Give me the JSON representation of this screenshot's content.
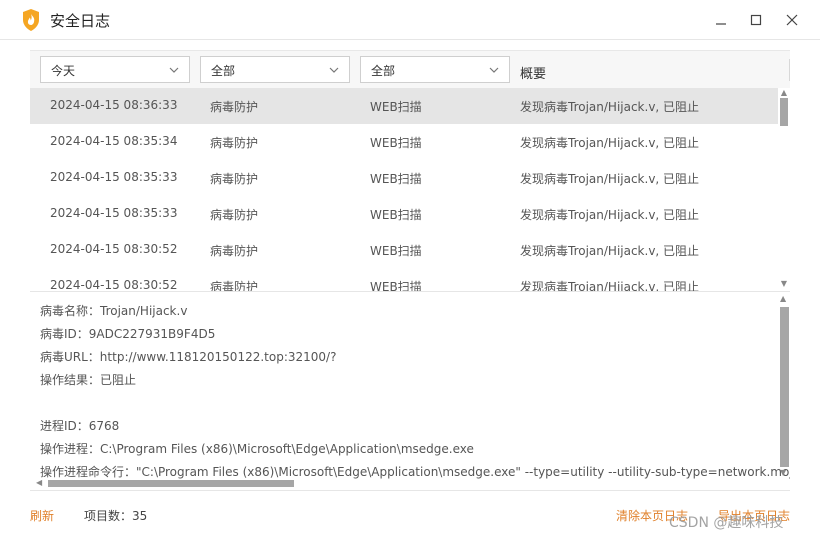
{
  "window": {
    "title": "安全日志",
    "app_icon": "shield-fire-icon",
    "controls": [
      "minimize-icon",
      "maximize-icon",
      "close-icon"
    ]
  },
  "filters": {
    "time": "今天",
    "category": "全部",
    "type": "全部",
    "summary_header": "概要"
  },
  "rows": [
    {
      "time": "2024-04-15 08:36:33",
      "category": "病毒防护",
      "type": "WEB扫描",
      "summary": "发现病毒Trojan/Hijack.v, 已阻止"
    },
    {
      "time": "2024-04-15 08:35:34",
      "category": "病毒防护",
      "type": "WEB扫描",
      "summary": "发现病毒Trojan/Hijack.v, 已阻止"
    },
    {
      "time": "2024-04-15 08:35:33",
      "category": "病毒防护",
      "type": "WEB扫描",
      "summary": "发现病毒Trojan/Hijack.v, 已阻止"
    },
    {
      "time": "2024-04-15 08:35:33",
      "category": "病毒防护",
      "type": "WEB扫描",
      "summary": "发现病毒Trojan/Hijack.v, 已阻止"
    },
    {
      "time": "2024-04-15 08:30:52",
      "category": "病毒防护",
      "type": "WEB扫描",
      "summary": "发现病毒Trojan/Hijack.v, 已阻止"
    },
    {
      "time": "2024-04-15 08:30:52",
      "category": "病毒防护",
      "type": "WEB扫描",
      "summary": "发现病毒Trojan/Hijack.v, 已阻止"
    }
  ],
  "details": {
    "virus_name": "病毒名称：Trojan/Hijack.v",
    "virus_id": "病毒ID：9ADC227931B9F4D5",
    "virus_url": "病毒URL：http://www.118120150122.top:32100/?",
    "result": "操作结果：已阻止",
    "pid": "进程ID：6768",
    "process": "操作进程：C:\\Program Files (x86)\\Microsoft\\Edge\\Application\\msedge.exe",
    "cmdline": "操作进程命令行：\"C:\\Program Files (x86)\\Microsoft\\Edge\\Application\\msedge.exe\" --type=utility --utility-sub-type=network.mojom.NetworkService"
  },
  "footer": {
    "refresh": "刷新",
    "item_count": "项目数：35",
    "clear": "清除本页日志",
    "export": "导出本页日志",
    "watermark": "CSDN @趣味科技"
  },
  "colors": {
    "accent": "#e0802a",
    "selected_row": "#e5e5e5",
    "scroll_thumb": "#a6a6a6"
  }
}
